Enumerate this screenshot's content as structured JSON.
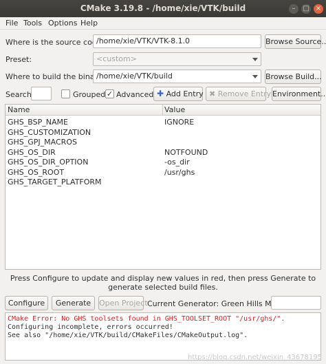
{
  "window": {
    "title": "CMake 3.19.8 - /home/xie/VTK/build",
    "close_glyph": "×",
    "minimize_glyph": "–",
    "maximize_glyph": "□"
  },
  "menu": [
    "File",
    "Tools",
    "Options",
    "Help"
  ],
  "source": {
    "label": "Where is the source code:",
    "value": "/home/xie/VTK/VTK-8.1.0",
    "browse_label": "Browse Source..."
  },
  "preset": {
    "label": "Preset:",
    "value": "<custom>"
  },
  "build": {
    "label": "Where to build the binaries:",
    "value": "/home/xie/VTK/build",
    "browse_label": "Browse Build..."
  },
  "search_bar": {
    "search_label": "Search:",
    "search_value": "",
    "grouped_label": "Grouped",
    "grouped_checked": false,
    "advanced_label": "Advanced",
    "advanced_checked": true,
    "add_entry_label": "Add Entry",
    "remove_entry_label": "Remove Entry",
    "environment_label": "Environment..."
  },
  "table": {
    "columns": [
      "Name",
      "Value"
    ],
    "rows": [
      {
        "name": "GHS_BSP_NAME",
        "value": "IGNORE"
      },
      {
        "name": "GHS_CUSTOMIZATION",
        "value": ""
      },
      {
        "name": "GHS_GPJ_MACROS",
        "value": ""
      },
      {
        "name": "GHS_OS_DIR",
        "value": "NOTFOUND"
      },
      {
        "name": "GHS_OS_DIR_OPTION",
        "value": "-os_dir"
      },
      {
        "name": "GHS_OS_ROOT",
        "value": "/usr/ghs"
      },
      {
        "name": "GHS_TARGET_PLATFORM",
        "value": ""
      }
    ]
  },
  "info_text": "Press Configure to update and display new values in red, then press Generate to generate selected build files.",
  "actions": {
    "configure_label": "Configure",
    "generate_label": "Generate",
    "open_project_label": "Open Project",
    "current_generator": "Current Generator: Green Hills MULTI",
    "generator_field": ""
  },
  "log": {
    "error_line": "CMake Error: No GHS toolsets found in GHS_TOOLSET_ROOT \"/usr/ghs/\".",
    "lines": [
      "Configuring incomplete, errors occurred!",
      "See also \"/home/xie/VTK/build/CMakeFiles/CMakeOutput.log\"."
    ]
  },
  "watermark": "https://blog.csdn.net/weixin_43678195",
  "colors": {
    "error": "#d8201f",
    "titlebar": "#3c3b37",
    "close_button": "#e0633d",
    "add_icon": "#3b64c8"
  }
}
